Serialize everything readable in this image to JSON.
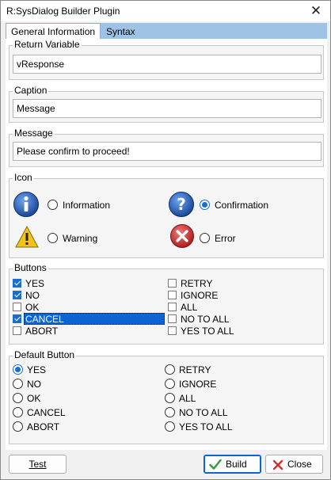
{
  "window": {
    "title": "R:SysDialog Builder Plugin",
    "close_glyph": "✕"
  },
  "tabs": [
    {
      "label": "General Information",
      "active": true
    },
    {
      "label": "Syntax",
      "active": false
    }
  ],
  "return_variable": {
    "label": "Return Variable",
    "value": "vResponse"
  },
  "caption": {
    "label": "Caption",
    "value": "Message"
  },
  "message": {
    "label": "Message",
    "value": "Please confirm to proceed!"
  },
  "icon_group": {
    "label": "Icon",
    "options": [
      {
        "label": "Information",
        "icon": "information-icon",
        "selected": false
      },
      {
        "label": "Confirmation",
        "icon": "question-icon",
        "selected": true
      },
      {
        "label": "Warning",
        "icon": "warning-icon",
        "selected": false
      },
      {
        "label": "Error",
        "icon": "error-icon",
        "selected": false
      }
    ]
  },
  "buttons_group": {
    "label": "Buttons",
    "left": [
      {
        "label": "YES",
        "checked": true
      },
      {
        "label": "NO",
        "checked": true
      },
      {
        "label": "OK",
        "checked": false
      },
      {
        "label": "CANCEL",
        "checked": true,
        "focused": true
      },
      {
        "label": "ABORT",
        "checked": false
      }
    ],
    "right": [
      {
        "label": "RETRY",
        "checked": false
      },
      {
        "label": "IGNORE",
        "checked": false
      },
      {
        "label": "ALL",
        "checked": false
      },
      {
        "label": "NO TO ALL",
        "checked": false
      },
      {
        "label": "YES TO ALL",
        "checked": false
      }
    ]
  },
  "default_group": {
    "label": "Default Button",
    "left": [
      {
        "label": "YES",
        "selected": true
      },
      {
        "label": "NO",
        "selected": false
      },
      {
        "label": "OK",
        "selected": false
      },
      {
        "label": "CANCEL",
        "selected": false
      },
      {
        "label": "ABORT",
        "selected": false
      }
    ],
    "right": [
      {
        "label": "RETRY",
        "selected": false
      },
      {
        "label": "IGNORE",
        "selected": false
      },
      {
        "label": "ALL",
        "selected": false
      },
      {
        "label": "NO TO ALL",
        "selected": false
      },
      {
        "label": "YES TO ALL",
        "selected": false
      }
    ]
  },
  "footer": {
    "test_label": "Test",
    "build_label": "Build",
    "close_label": "Close"
  },
  "colors": {
    "accent": "#0a64d2",
    "tab_strip": "#9ec3e6",
    "info_blue": "#1e5eb8",
    "warning_yellow": "#f2c21b",
    "error_red": "#d32f2f"
  }
}
